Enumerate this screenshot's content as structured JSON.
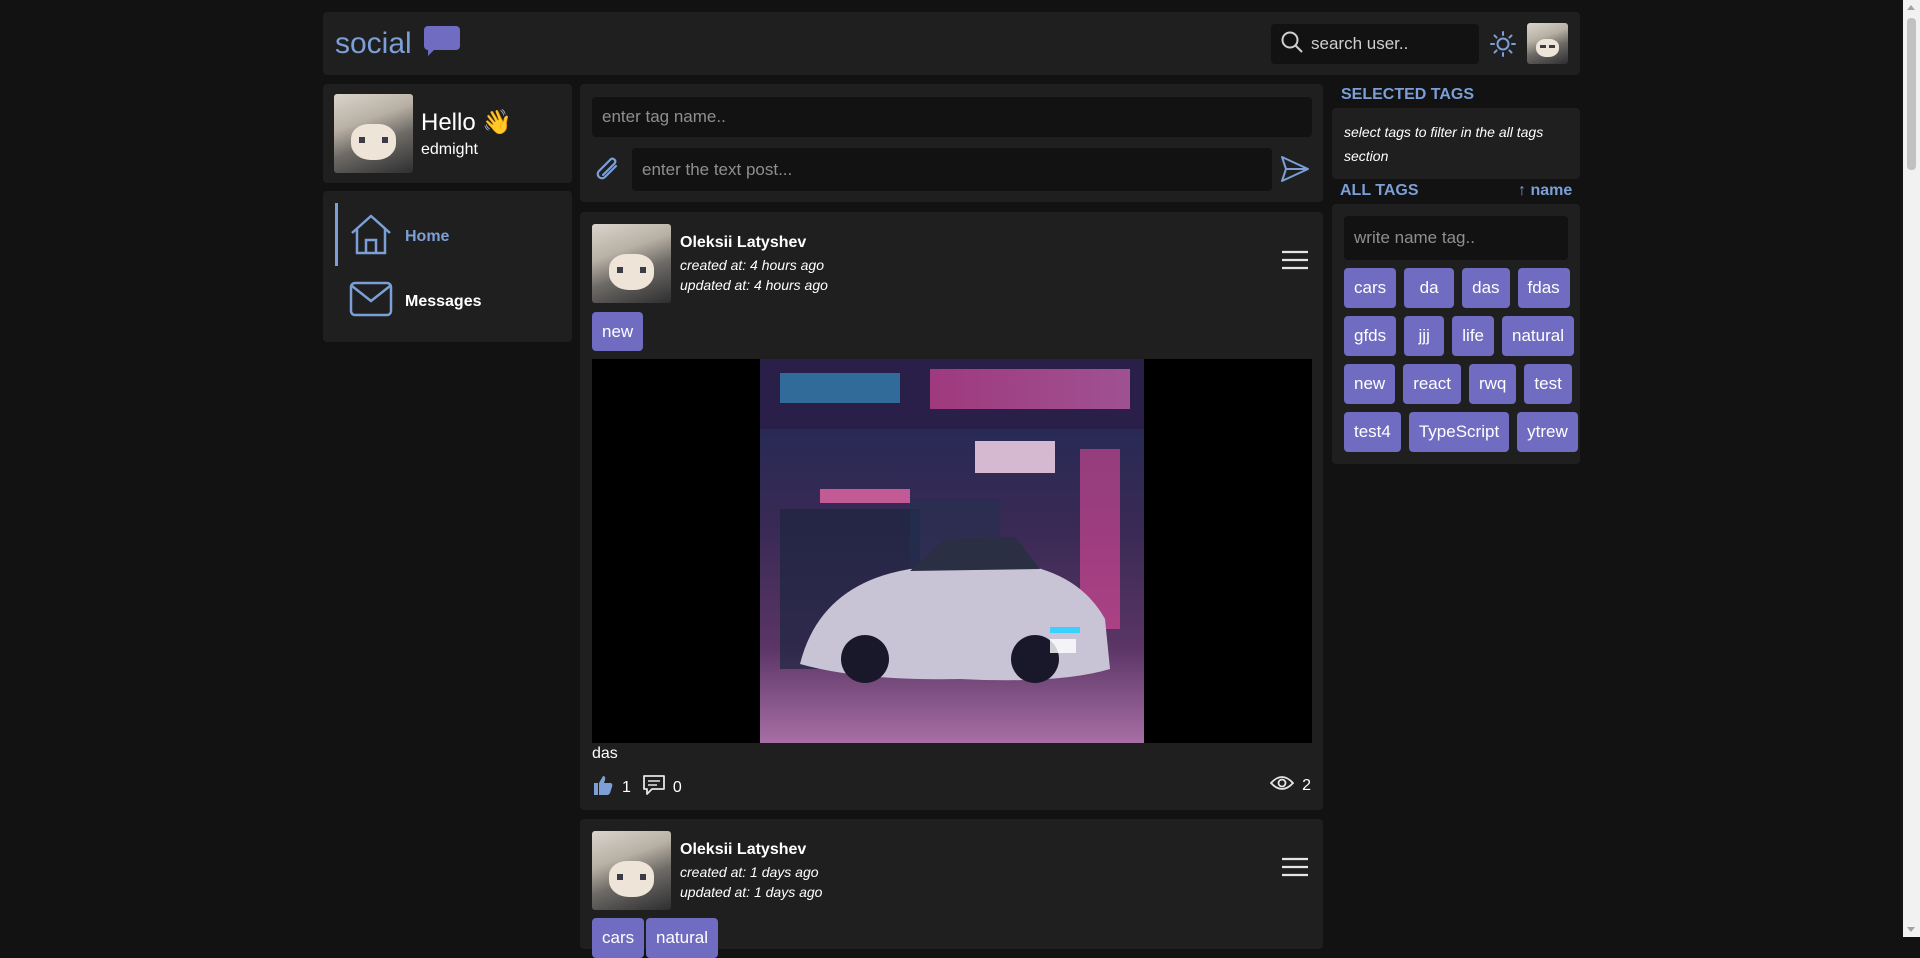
{
  "header": {
    "logo_text": "social",
    "search_placeholder": "search user..",
    "icons": [
      "chat-bubble-icon",
      "search-icon",
      "sun-icon",
      "avatar"
    ]
  },
  "profile": {
    "greeting": "Hello 👋",
    "username": "edmight"
  },
  "nav": {
    "items": [
      {
        "label": "Home",
        "icon": "home-icon",
        "active": true
      },
      {
        "label": "Messages",
        "icon": "envelope-icon",
        "active": false
      }
    ]
  },
  "composer": {
    "tag_placeholder": "enter tag name..",
    "text_placeholder": "enter the text post..."
  },
  "posts": [
    {
      "author": "Oleksii Latyshev",
      "created": "created at: 4 hours ago",
      "updated": "updated at: 4 hours ago",
      "tags": [
        "new"
      ],
      "text": "das",
      "likes": "1",
      "comments": "0",
      "views": "2"
    },
    {
      "author": "Oleksii Latyshev",
      "created": "created at: 1 days ago",
      "updated": "updated at: 1 days ago",
      "tags": [
        "cars",
        "natural"
      ]
    }
  ],
  "sidebar": {
    "selected_title": "SELECTED TAGS",
    "selected_hint": "select tags to filter in the all tags section",
    "all_title": "ALL TAGS",
    "sort_label": "↑ name",
    "tag_search_placeholder": "write name tag..",
    "tags": [
      "cars",
      "da",
      "das",
      "fdas",
      "gfds",
      "jjj",
      "life",
      "natural",
      "new",
      "react",
      "rwq",
      "test",
      "test4",
      "TypeScript",
      "ytrew"
    ]
  },
  "colors": {
    "accent": "#6f6cc1",
    "accent_light": "#7b9fd6",
    "background": "#121212",
    "panel": "#1f1f1f"
  }
}
